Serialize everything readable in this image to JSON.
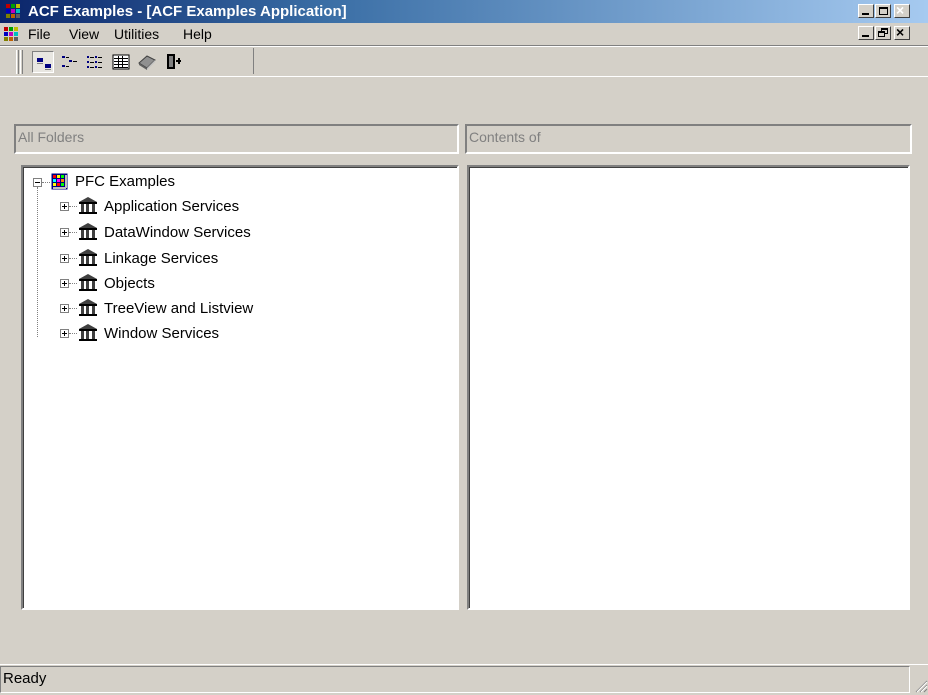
{
  "window": {
    "title": "ACF Examples - [ACF Examples Application]"
  },
  "menu": {
    "items": [
      {
        "label": "File"
      },
      {
        "label": "View"
      },
      {
        "label": "Utilities"
      },
      {
        "label": "Help"
      }
    ]
  },
  "toolbar": {
    "buttons": [
      {
        "icon": "large-icons-view-icon",
        "pressed": true
      },
      {
        "icon": "small-icons-view-icon",
        "pressed": false
      },
      {
        "icon": "list-view-icon",
        "pressed": false
      },
      {
        "icon": "details-view-icon",
        "pressed": false
      },
      {
        "icon": "help-book-icon",
        "pressed": false
      },
      {
        "icon": "exit-door-icon",
        "pressed": false
      }
    ]
  },
  "left_panel": {
    "header": "All Folders",
    "tree": {
      "root": {
        "label": "PFC Examples",
        "expanded": true,
        "icon": "grid-icon"
      },
      "children": [
        {
          "label": "Application Services",
          "icon": "library-icon"
        },
        {
          "label": "DataWindow Services",
          "icon": "library-icon"
        },
        {
          "label": "Linkage Services",
          "icon": "library-icon"
        },
        {
          "label": "Objects",
          "icon": "library-icon"
        },
        {
          "label": "TreeView and Listview",
          "icon": "library-icon"
        },
        {
          "label": "Window Services",
          "icon": "library-icon"
        }
      ]
    }
  },
  "right_panel": {
    "header": "Contents of"
  },
  "status": {
    "text": "Ready"
  },
  "colors": {
    "title_active": "#0a246a",
    "face": "#d4d0c8",
    "shadow": "#808080"
  }
}
